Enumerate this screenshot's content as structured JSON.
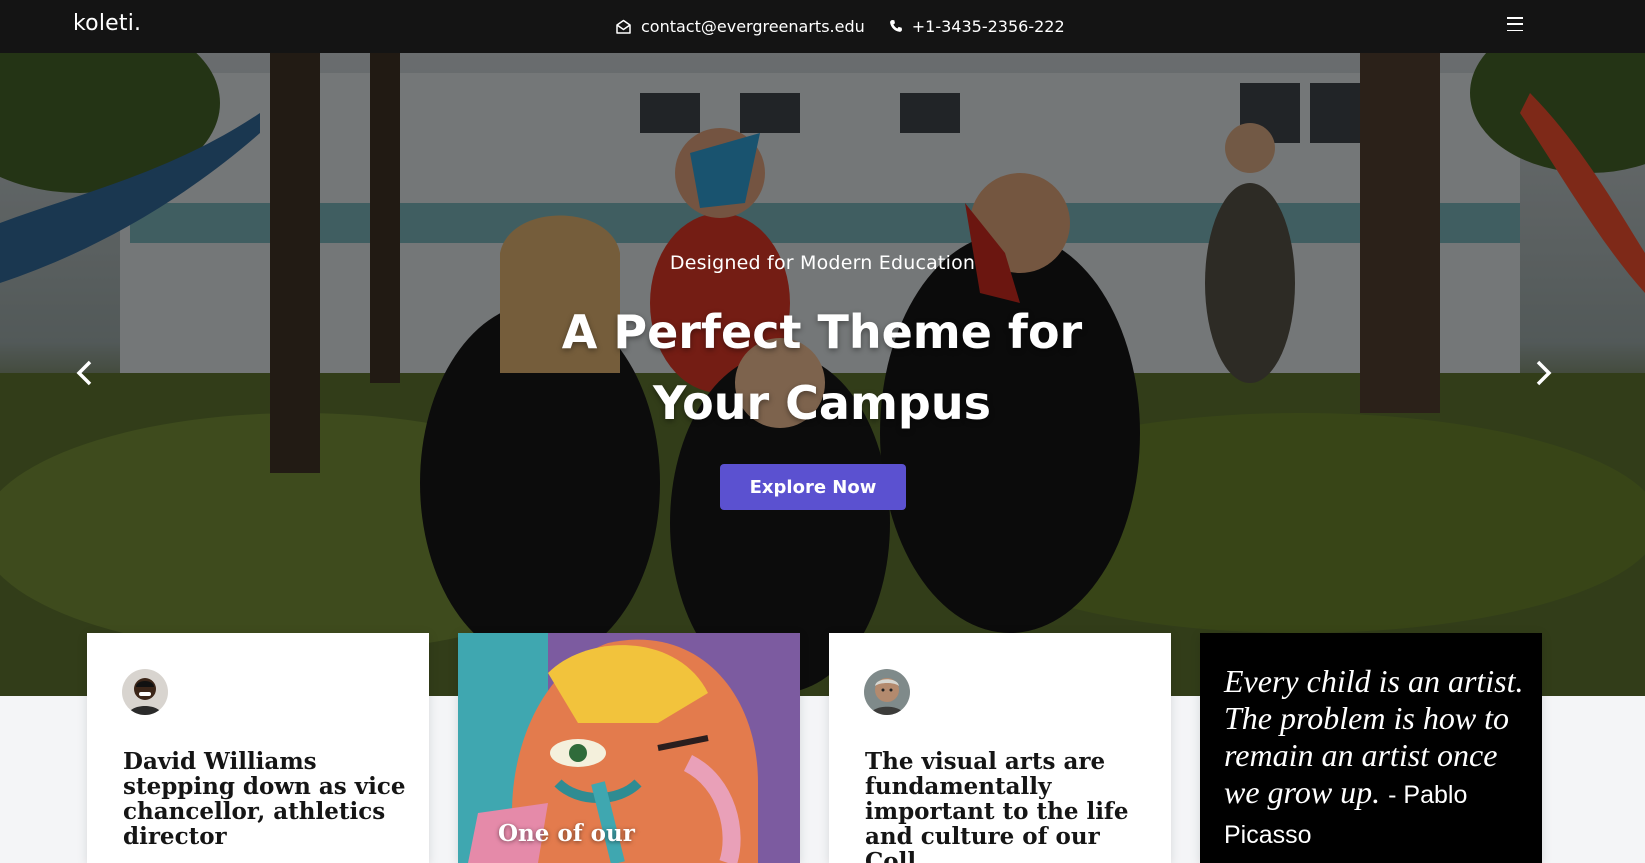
{
  "header": {
    "brand": "koleti.",
    "email": "contact@evergreenarts.edu",
    "phone": "+1-3435-2356-222",
    "icons": [
      "envelope-icon",
      "phone-icon",
      "menu-icon"
    ]
  },
  "hero": {
    "subtitle": "Designed for Modern Education",
    "title": "A Perfect Theme for Your Campus",
    "cta_label": "Explore Now",
    "accent_color": "#5b51d0",
    "arrows": [
      "chevron-left-icon",
      "chevron-right-icon"
    ]
  },
  "cards": [
    {
      "type": "news",
      "title": "David Williams stepping down as vice chancellor, athletics director"
    },
    {
      "type": "image",
      "caption": "One of our"
    },
    {
      "type": "news",
      "title": "The visual arts are fundamentally important to the life and culture of our Coll"
    },
    {
      "type": "quote",
      "text": "Every child is an artist. The problem is how to remain an artist once we grow up.",
      "author": "- Pablo Picasso"
    }
  ]
}
